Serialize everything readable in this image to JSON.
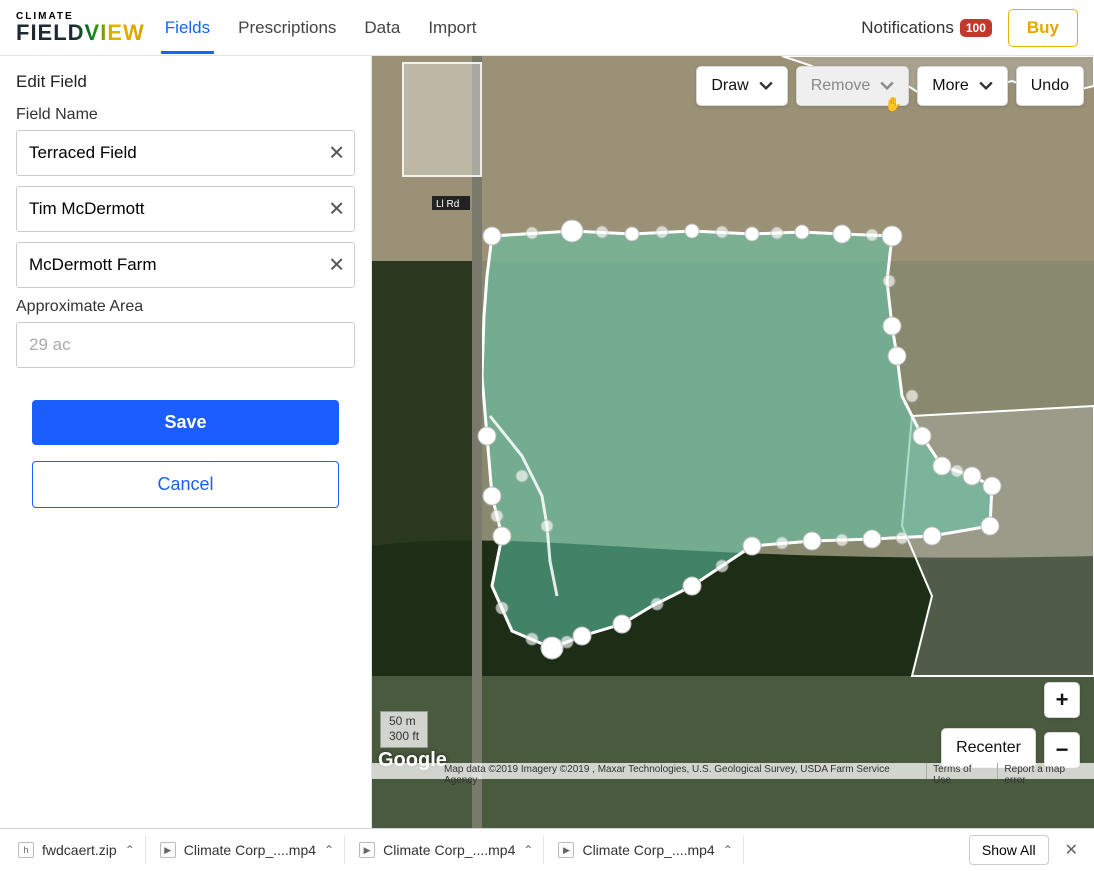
{
  "logo": {
    "line1": "CLIMATE",
    "line2": "FIELDVIEW"
  },
  "nav": {
    "fields": "Fields",
    "prescriptions": "Prescriptions",
    "data": "Data",
    "import": "Import"
  },
  "header": {
    "notifications_label": "Notifications",
    "notifications_count": "100",
    "buy": "Buy"
  },
  "sidebar": {
    "title": "Edit Field",
    "field_name_label": "Field Name",
    "field_name_value": "Terraced Field",
    "owner_value": "Tim McDermott",
    "farm_value": "McDermott Farm",
    "area_label": "Approximate Area",
    "area_value": "29 ac",
    "save": "Save",
    "cancel": "Cancel"
  },
  "toolbar": {
    "draw": "Draw",
    "remove": "Remove",
    "more": "More",
    "undo": "Undo"
  },
  "map": {
    "scale_m": "50 m",
    "scale_ft": "300 ft",
    "google": "Google",
    "attribution": "Map data ©2019 Imagery ©2019 , Maxar Technologies, U.S. Geological Survey, USDA Farm Service Agency",
    "terms": "Terms of Use",
    "report": "Report a map error",
    "recenter": "Recenter",
    "street_label": "Ll Rd"
  },
  "downloads": {
    "items": [
      {
        "name": "fwdcaert.zip",
        "icon": "h"
      },
      {
        "name": "Climate Corp_....mp4",
        "icon": "▶"
      },
      {
        "name": "Climate Corp_....mp4",
        "icon": "▶"
      },
      {
        "name": "Climate Corp_....mp4",
        "icon": "▶"
      }
    ],
    "showall": "Show All"
  }
}
